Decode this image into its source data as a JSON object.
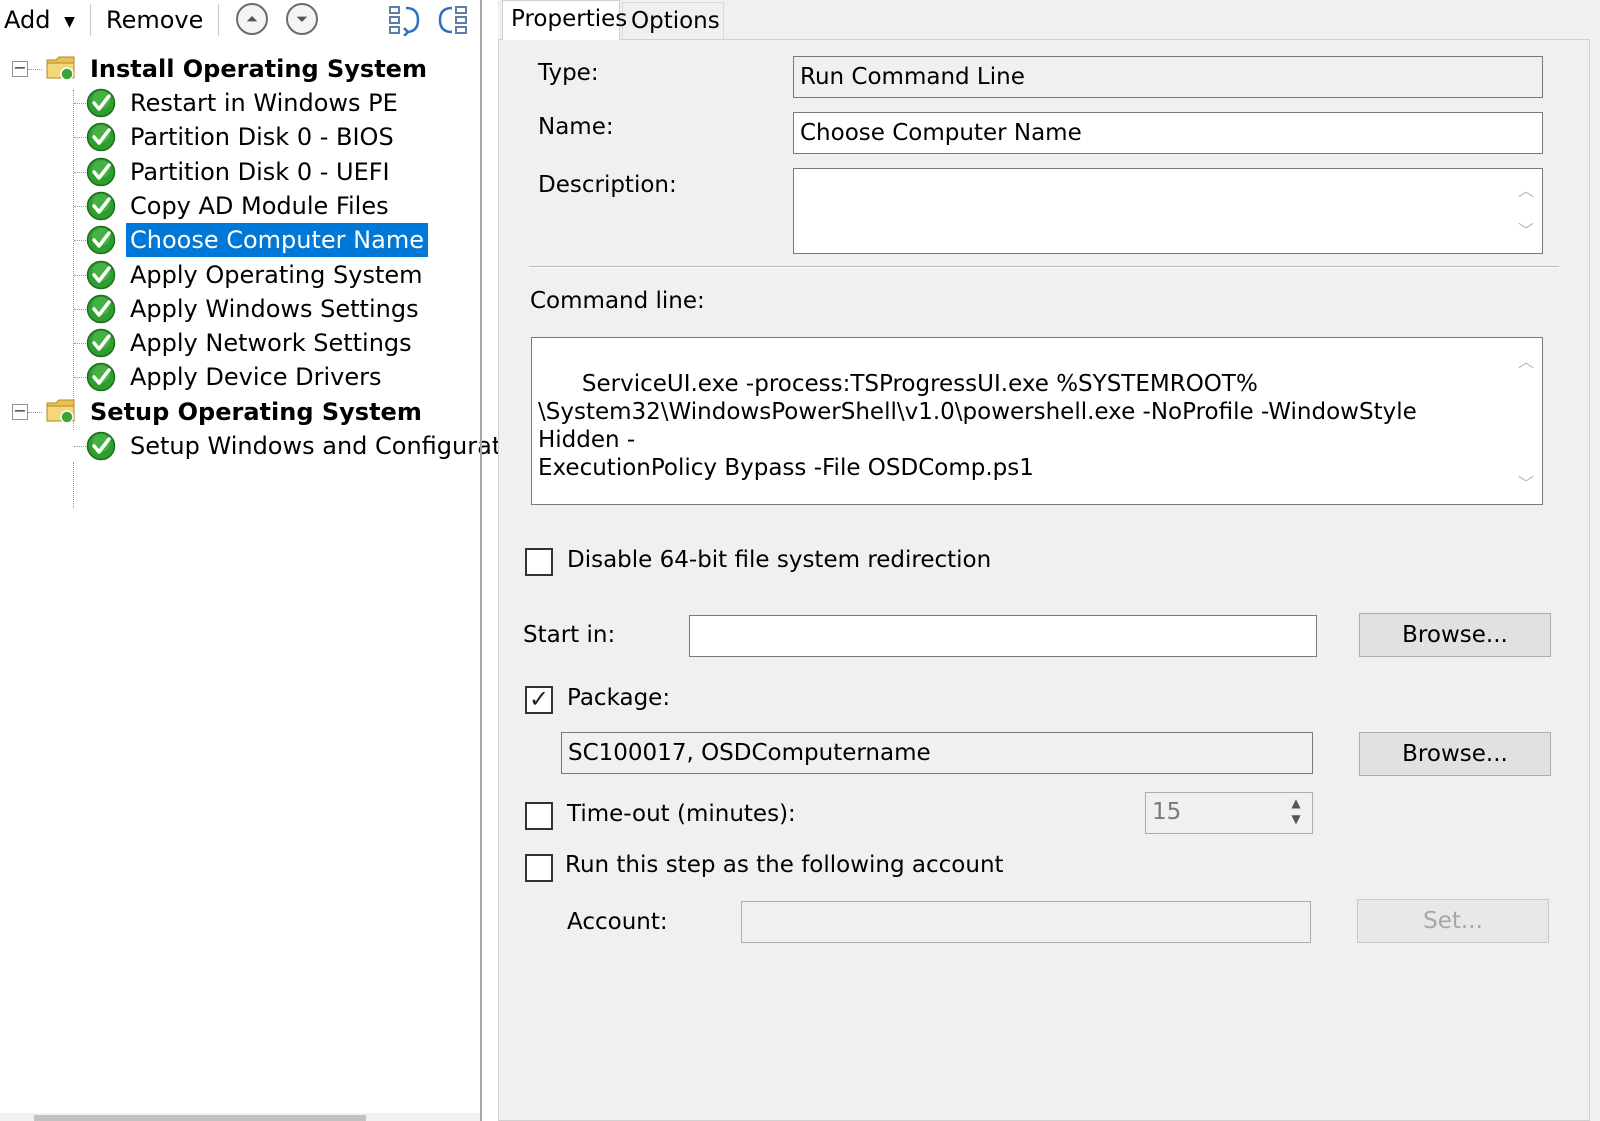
{
  "toolbar": {
    "add_label": "Add",
    "remove_label": "Remove"
  },
  "tree": {
    "groups": [
      {
        "label": "Install Operating System",
        "steps": [
          "Restart in Windows PE",
          "Partition Disk 0 - BIOS",
          "Partition Disk 0 - UEFI",
          "Copy AD Module Files",
          "Choose Computer Name",
          "Apply Operating System",
          "Apply Windows Settings",
          "Apply Network Settings",
          "Apply Device Drivers"
        ]
      },
      {
        "label": "Setup Operating System",
        "steps": [
          "Setup Windows and Configuratior"
        ]
      }
    ],
    "selected_step": "Choose Computer Name"
  },
  "tabs": {
    "properties": "Properties",
    "options": "Options"
  },
  "properties": {
    "type_label": "Type:",
    "type_value": "Run Command Line",
    "name_label": "Name:",
    "name_value": "Choose Computer Name",
    "description_label": "Description:",
    "description_value": "",
    "command_line_label": "Command line:",
    "command_line_value": "ServiceUI.exe -process:TSProgressUI.exe %SYSTEMROOT%\n\\System32\\WindowsPowerShell\\v1.0\\powershell.exe -NoProfile -WindowStyle Hidden -\nExecutionPolicy Bypass -File OSDComp.ps1",
    "disable64_label": "Disable 64-bit file system redirection",
    "disable64_checked": false,
    "start_in_label": "Start in:",
    "start_in_value": "",
    "browse_label": "Browse...",
    "package_label": "Package:",
    "package_checked": true,
    "package_value": "SC100017, OSDComputername",
    "timeout_label": "Time-out (minutes):",
    "timeout_checked": false,
    "timeout_value": "15",
    "run_as_label": "Run this step as the following account",
    "run_as_checked": false,
    "account_label": "Account:",
    "account_value": "",
    "set_label": "Set..."
  },
  "colors": {
    "selection": "#0078d7",
    "panel_background": "#f0f0f0",
    "check_green": "#2e9e2e"
  },
  "icons": {
    "step": "green-check-icon",
    "group": "folder-icon",
    "move_up": "move-up-icon",
    "move_down": "move-down-icon"
  }
}
